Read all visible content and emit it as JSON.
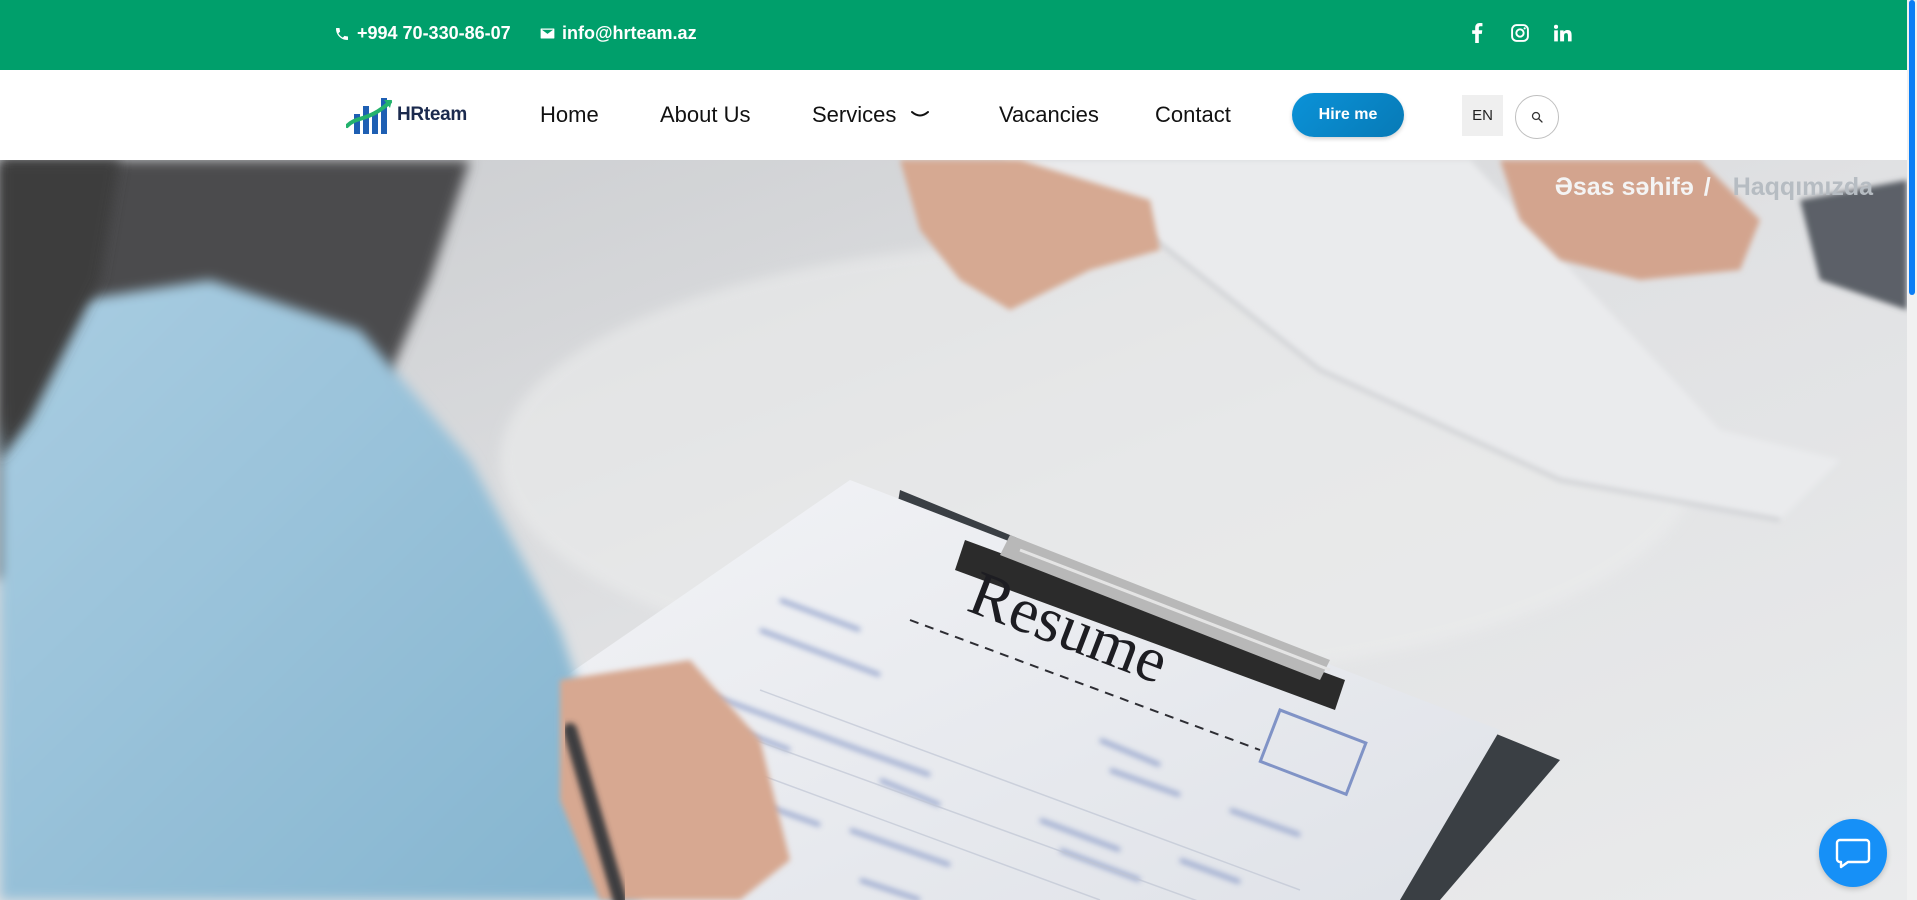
{
  "topbar": {
    "phone": "+994 70-330-86-07",
    "email": "info@hrteam.az",
    "background_color": "#009f6b",
    "phone_icon": "phone-icon",
    "email_icon": "envelope-icon",
    "social": [
      "facebook-icon",
      "instagram-icon",
      "linkedin-icon"
    ]
  },
  "navbar": {
    "logo_text": "HRteam",
    "items": [
      {
        "label": "Home"
      },
      {
        "label": "About Us"
      },
      {
        "label": "Services"
      },
      {
        "label": "Vacancies"
      },
      {
        "label": "Contact"
      }
    ],
    "services_icon": "chevron-down-icon",
    "hire_label": "Hire me",
    "hire_color": "#0b8bd0",
    "lang_label": "EN",
    "search_icon": "search-icon"
  },
  "hero": {
    "breadcrumb": {
      "home": "Əsas səhifə",
      "separator": "/",
      "current": "Haqqımızda"
    },
    "resume_text": "Resume"
  },
  "chat": {
    "icon": "chat-bubble-icon",
    "color": "#1690f7"
  },
  "scrollbar": {
    "thumb_color": "#0a7ef5"
  }
}
